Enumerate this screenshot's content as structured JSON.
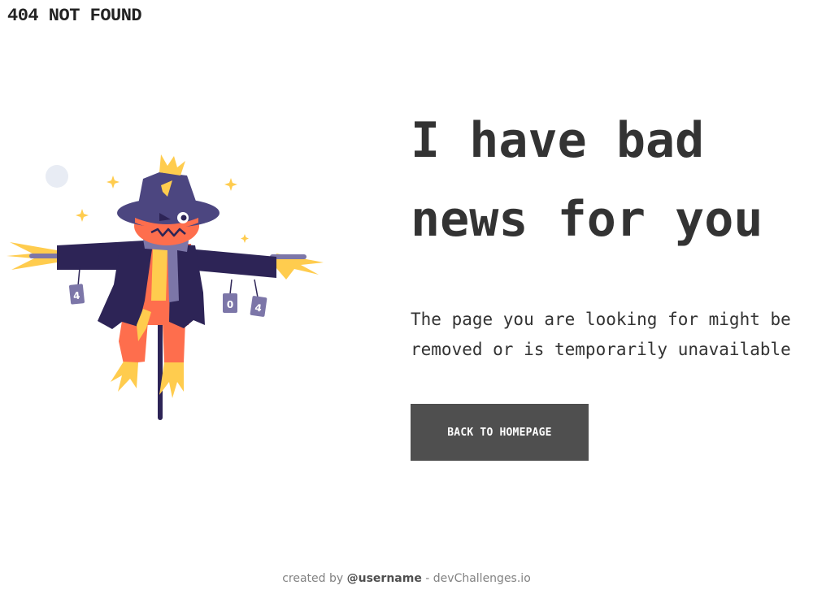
{
  "brand": {
    "text": "404 NOT FOUND"
  },
  "illustration": {
    "icon": "scarecrow-illustration",
    "sign_digits": [
      "4",
      "0",
      "4"
    ],
    "colors": {
      "hat": "#4c4680",
      "coat": "#2d2456",
      "face": "#fe6e4d",
      "straw": "#ffcc4e",
      "pole": "#2d2456",
      "moon": "#e8ecf4",
      "sign": "#7c76a8"
    }
  },
  "content": {
    "headline": "I have bad news for you",
    "message": "The page you are looking for might be removed or is temporarily unavailable",
    "button_label": "BACK TO HOMEPAGE"
  },
  "footer": {
    "prefix": "created by ",
    "username": "@username",
    "suffix": " - devChallenges.io"
  },
  "colors": {
    "text": "#333333",
    "button_bg": "#4f4f4f",
    "button_text": "#ffffff",
    "footer_text": "#828282"
  }
}
